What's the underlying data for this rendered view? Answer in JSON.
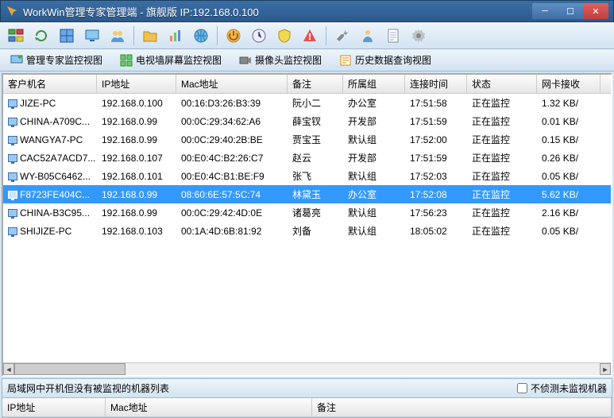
{
  "titlebar": {
    "title": "WorkWin管理专家管理端 - 旗舰版 IP:192.168.0.100"
  },
  "views": {
    "v1": "管理专家监控视图",
    "v2": "电视墙屏幕监控视图",
    "v3": "摄像头监控视图",
    "v4": "历史数据查询视图"
  },
  "columns": {
    "c0": "客户机名",
    "c1": "IP地址",
    "c2": "Mac地址",
    "c3": "备注",
    "c4": "所属组",
    "c5": "连接时间",
    "c6": "状态",
    "c7": "网卡接收"
  },
  "rows": [
    {
      "name": "JIZE-PC",
      "ip": "192.168.0.100",
      "mac": "00:16:D3:26:B3:39",
      "note": "阮小二",
      "group": "办公室",
      "time": "17:51:58",
      "status": "正在监控",
      "rx": "1.32 KB/"
    },
    {
      "name": "CHINA-A709C...",
      "ip": "192.168.0.99",
      "mac": "00:0C:29:34:62:A6",
      "note": "薛宝钗",
      "group": "开发部",
      "time": "17:51:59",
      "status": "正在监控",
      "rx": "0.01 KB/"
    },
    {
      "name": "WANGYA7-PC",
      "ip": "192.168.0.99",
      "mac": "00:0C:29:40:2B:BE",
      "note": "贾宝玉",
      "group": "默认组",
      "time": "17:52:00",
      "status": "正在监控",
      "rx": "0.15 KB/"
    },
    {
      "name": "CAC52A7ACD7...",
      "ip": "192.168.0.107",
      "mac": "00:E0:4C:B2:26:C7",
      "note": "赵云",
      "group": "开发部",
      "time": "17:51:59",
      "status": "正在监控",
      "rx": "0.26 KB/"
    },
    {
      "name": "WY-B05C6462...",
      "ip": "192.168.0.101",
      "mac": "00:E0:4C:B1:BE:F9",
      "note": "张飞",
      "group": "默认组",
      "time": "17:52:03",
      "status": "正在监控",
      "rx": "0.05 KB/"
    },
    {
      "name": "F8723FE404C...",
      "ip": "192.168.0.99",
      "mac": "08:60:6E:57:5C:74",
      "note": "林黛玉",
      "group": "办公室",
      "time": "17:52:08",
      "status": "正在监控",
      "rx": "5.62 KB/",
      "selected": true
    },
    {
      "name": "CHINA-B3C95...",
      "ip": "192.168.0.99",
      "mac": "00:0C:29:42:4D:0E",
      "note": "诸葛亮",
      "group": "默认组",
      "time": "17:56:23",
      "status": "正在监控",
      "rx": "2.16 KB/"
    },
    {
      "name": "SHIJIZE-PC",
      "ip": "192.168.0.103",
      "mac": "00:1A:4D:6B:81:92",
      "note": "刘备",
      "group": "默认组",
      "time": "18:05:02",
      "status": "正在监控",
      "rx": "0.05 KB/"
    }
  ],
  "bottom": {
    "label": "局域网中开机但没有被监视的机器列表",
    "checkbox": "不侦测未监视机器",
    "cols": {
      "b0": "IP地址",
      "b1": "Mac地址",
      "b2": "备注"
    }
  }
}
